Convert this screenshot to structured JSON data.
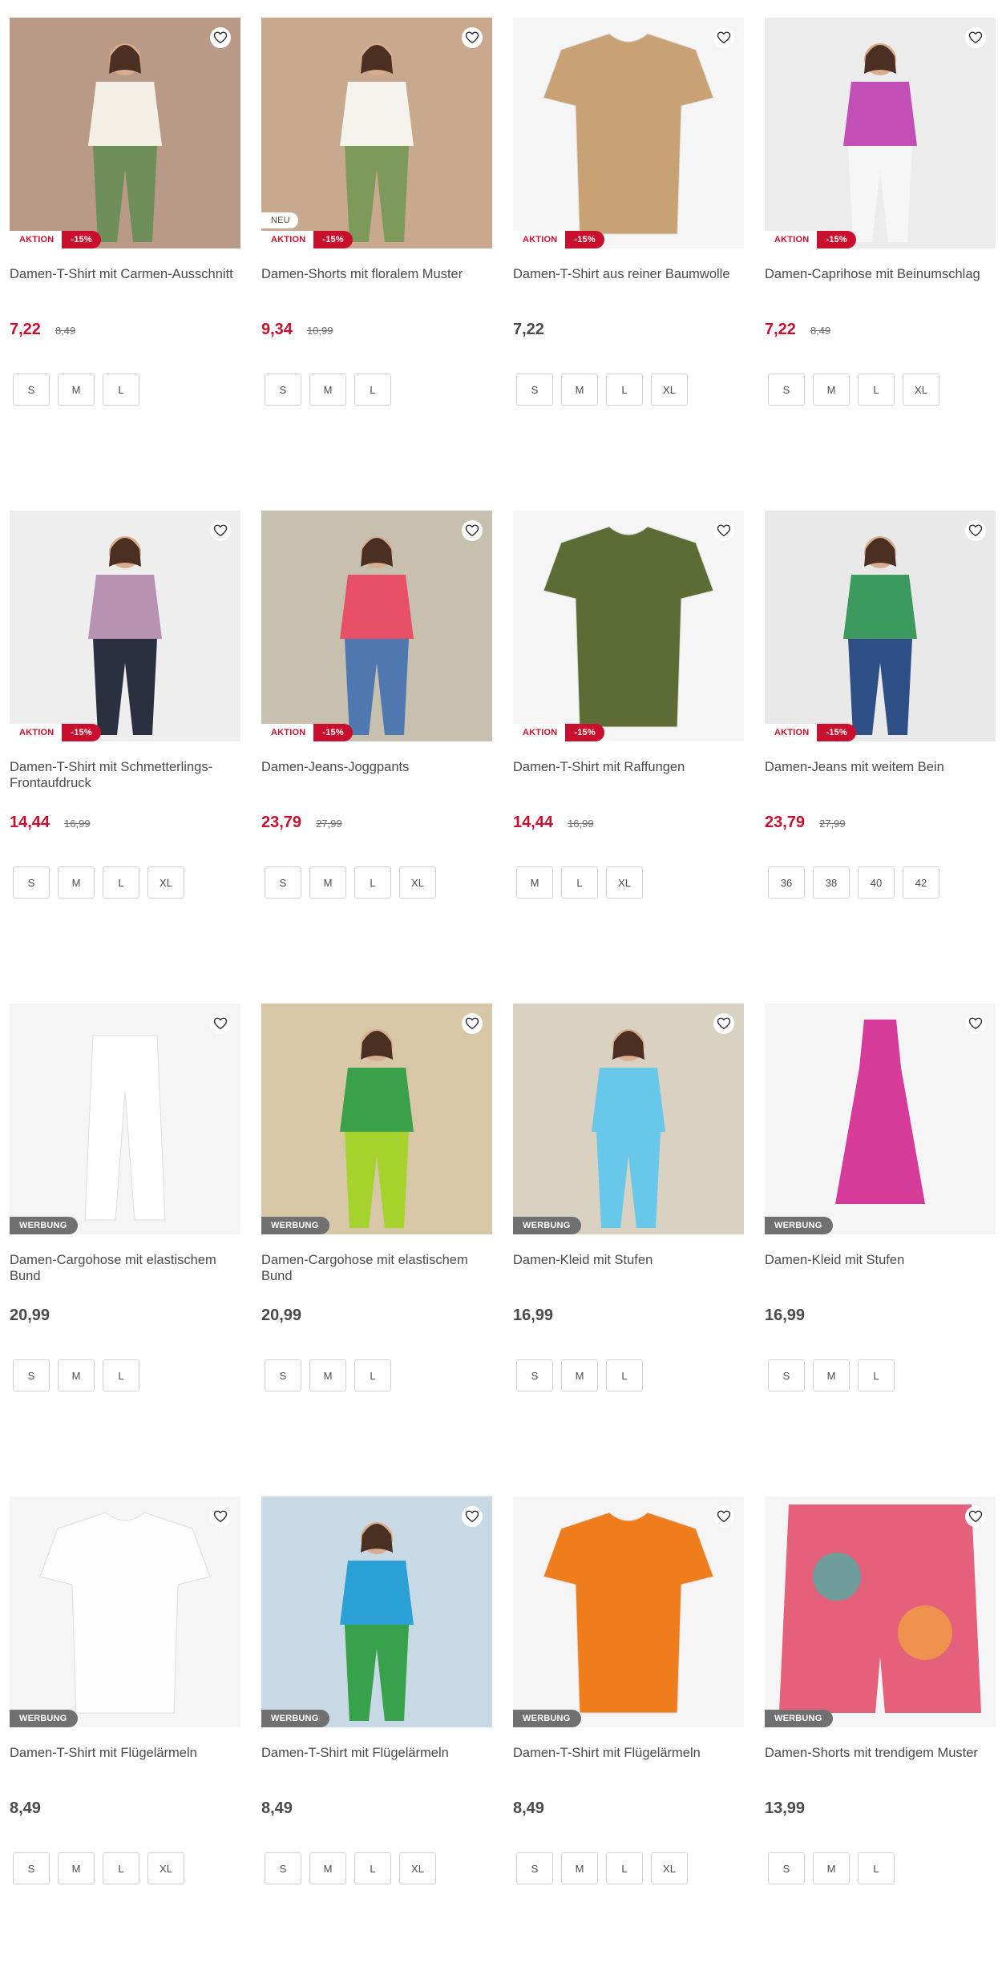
{
  "colors": {
    "sale_red": "#c8102e",
    "text": "#4a4a4a",
    "werbung_bg": "#707070",
    "border": "#cfcfcf"
  },
  "products": [
    {
      "title": "Damen-T-Shirt mit Carmen-Ausschnitt",
      "price": "7,22",
      "old_price": "8,49",
      "sale": true,
      "badges": [
        "AKTION",
        "-15%"
      ],
      "neu": "",
      "werbung": "",
      "sizes": [
        "S",
        "M",
        "L"
      ],
      "icon": "heart-icon"
    },
    {
      "title": "Damen-Shorts mit floralem Muster",
      "price": "9,34",
      "old_price": "10,99",
      "sale": true,
      "badges": [
        "AKTION",
        "-15%"
      ],
      "neu": "NEU",
      "werbung": "",
      "sizes": [
        "S",
        "M",
        "L"
      ],
      "icon": "heart-icon"
    },
    {
      "title": "Damen-T-Shirt aus reiner Baumwolle",
      "price": "7,22",
      "old_price": "",
      "sale": false,
      "badges": [
        "AKTION",
        "-15%"
      ],
      "neu": "",
      "werbung": "",
      "sizes": [
        "S",
        "M",
        "L",
        "XL"
      ],
      "icon": "heart-icon"
    },
    {
      "title": "Damen-Caprihose mit Beinumschlag",
      "price": "7,22",
      "old_price": "8,49",
      "sale": true,
      "badges": [
        "AKTION",
        "-15%"
      ],
      "neu": "",
      "werbung": "",
      "sizes": [
        "S",
        "M",
        "L",
        "XL"
      ],
      "icon": "heart-icon"
    },
    {
      "title": "Damen-T-Shirt mit Schmetterlings-Frontaufdruck",
      "price": "14,44",
      "old_price": "16,99",
      "sale": true,
      "badges": [
        "AKTION",
        "-15%"
      ],
      "neu": "",
      "werbung": "",
      "sizes": [
        "S",
        "M",
        "L",
        "XL"
      ],
      "icon": "heart-icon"
    },
    {
      "title": "Damen-Jeans-Joggpants",
      "price": "23,79",
      "old_price": "27,99",
      "sale": true,
      "badges": [
        "AKTION",
        "-15%"
      ],
      "neu": "",
      "werbung": "",
      "sizes": [
        "S",
        "M",
        "L",
        "XL"
      ],
      "icon": "heart-icon"
    },
    {
      "title": "Damen-T-Shirt mit Raffungen",
      "price": "14,44",
      "old_price": "16,99",
      "sale": true,
      "badges": [
        "AKTION",
        "-15%"
      ],
      "neu": "",
      "werbung": "",
      "sizes": [
        "M",
        "L",
        "XL"
      ],
      "icon": "heart-icon"
    },
    {
      "title": "Damen-Jeans mit weitem Bein",
      "price": "23,79",
      "old_price": "27,99",
      "sale": true,
      "badges": [
        "AKTION",
        "-15%"
      ],
      "neu": "",
      "werbung": "",
      "sizes": [
        "36",
        "38",
        "40",
        "42"
      ],
      "icon": "heart-icon"
    },
    {
      "title": "Damen-Cargohose mit elastischem Bund",
      "price": "20,99",
      "old_price": "",
      "sale": false,
      "badges": [],
      "neu": "",
      "werbung": "WERBUNG",
      "sizes": [
        "S",
        "M",
        "L"
      ],
      "icon": "heart-icon"
    },
    {
      "title": "Damen-Cargohose mit elastischem Bund",
      "price": "20,99",
      "old_price": "",
      "sale": false,
      "badges": [],
      "neu": "",
      "werbung": "WERBUNG",
      "sizes": [
        "S",
        "M",
        "L"
      ],
      "icon": "heart-icon"
    },
    {
      "title": "Damen-Kleid mit Stufen",
      "price": "16,99",
      "old_price": "",
      "sale": false,
      "badges": [],
      "neu": "",
      "werbung": "WERBUNG",
      "sizes": [
        "S",
        "M",
        "L"
      ],
      "icon": "heart-icon"
    },
    {
      "title": "Damen-Kleid mit Stufen",
      "price": "16,99",
      "old_price": "",
      "sale": false,
      "badges": [],
      "neu": "",
      "werbung": "WERBUNG",
      "sizes": [
        "S",
        "M",
        "L"
      ],
      "icon": "heart-icon"
    },
    {
      "title": "Damen-T-Shirt mit Flügelärmeln",
      "price": "8,49",
      "old_price": "",
      "sale": false,
      "badges": [],
      "neu": "",
      "werbung": "WERBUNG",
      "sizes": [
        "S",
        "M",
        "L",
        "XL"
      ],
      "icon": "heart-icon"
    },
    {
      "title": "Damen-T-Shirt mit Flügelärmeln",
      "price": "8,49",
      "old_price": "",
      "sale": false,
      "badges": [],
      "neu": "",
      "werbung": "WERBUNG",
      "sizes": [
        "S",
        "M",
        "L",
        "XL"
      ],
      "icon": "heart-icon"
    },
    {
      "title": "Damen-T-Shirt mit Flügelärmeln",
      "price": "8,49",
      "old_price": "",
      "sale": false,
      "badges": [],
      "neu": "",
      "werbung": "WERBUNG",
      "sizes": [
        "S",
        "M",
        "L",
        "XL"
      ],
      "icon": "heart-icon"
    },
    {
      "title": "Damen-Shorts mit trendigem Muster",
      "price": "13,99",
      "old_price": "",
      "sale": false,
      "badges": [],
      "neu": "",
      "werbung": "WERBUNG",
      "sizes": [
        "S",
        "M",
        "L"
      ],
      "icon": "heart-icon"
    }
  ]
}
